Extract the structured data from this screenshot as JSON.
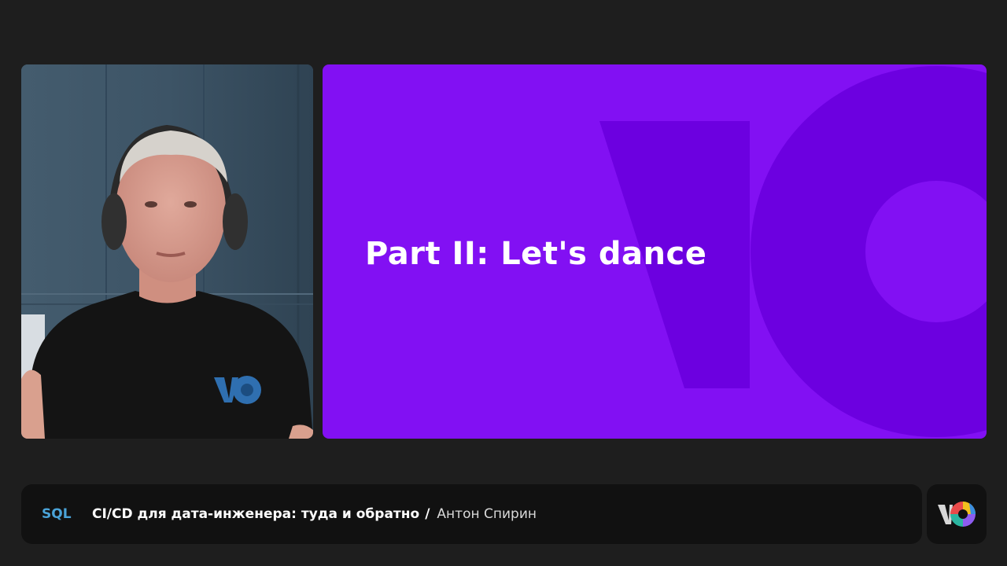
{
  "slide": {
    "title": "Part II: Let's dance"
  },
  "caption": {
    "topic": "SQL",
    "talk_title": "CI/CD для дата-инженера: туда и обратно",
    "separator": "/",
    "speaker": "Антон Спирин"
  },
  "colors": {
    "background": "#1e1e1e",
    "slide_background": "#8210f3",
    "slide_shape": "#6c00e0",
    "caption_bar": "#111111",
    "topic_tag": "#4aa3d8"
  },
  "icons": {
    "brand_logo": "vo-brand-logo-icon"
  }
}
